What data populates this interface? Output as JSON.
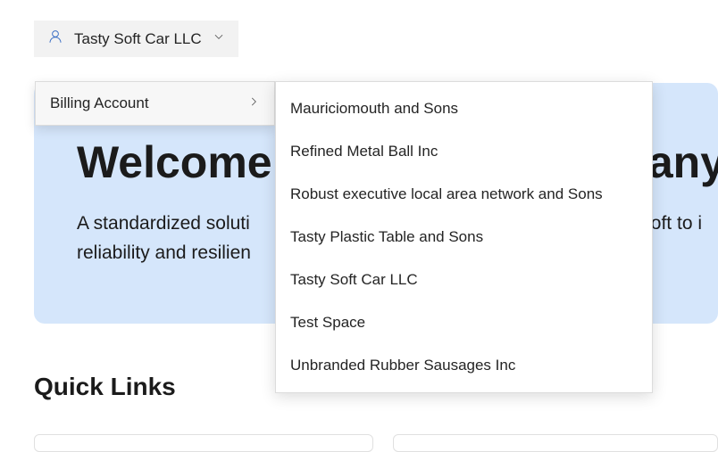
{
  "account_selector": {
    "selected": "Tasty Soft Car LLC"
  },
  "dropdown": {
    "billing_account_label": "Billing Account"
  },
  "submenu": {
    "items": [
      "Mauriciomouth and Sons",
      "Refined Metal Ball Inc",
      "Robust executive local area network and Sons",
      "Tasty Plastic Table and Sons",
      "Tasty Soft Car LLC",
      "Test Space",
      "Unbranded Rubber Sausages Inc"
    ]
  },
  "banner": {
    "title_left": "Welcome t",
    "title_right": "fany",
    "subtitle_line1_left": "A standardized soluti",
    "subtitle_line1_right": "oft to i",
    "subtitle_line2_left": "reliability and resilien"
  },
  "quick_links": {
    "heading": "Quick Links"
  }
}
